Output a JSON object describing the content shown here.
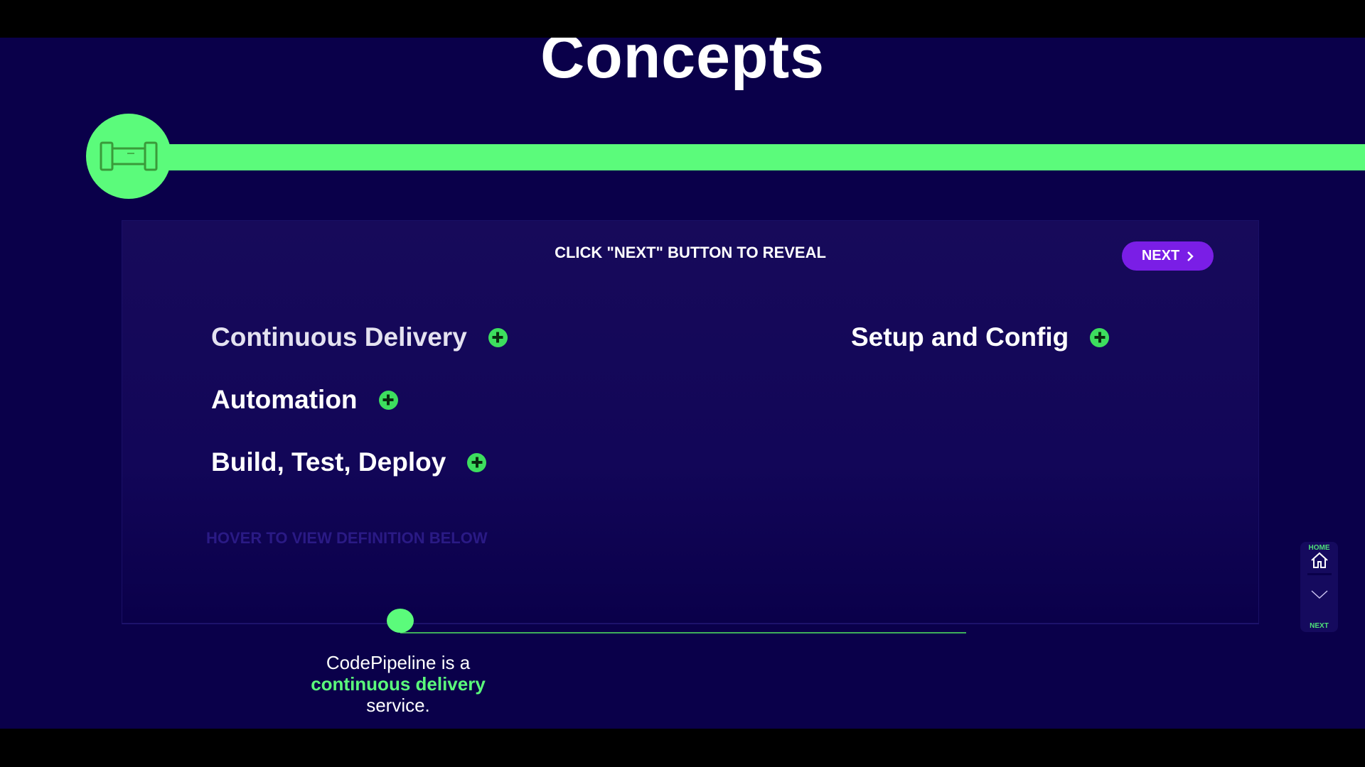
{
  "title": "Concepts",
  "header_icon": "pipeline-icon",
  "panel": {
    "hint": "CLICK \"NEXT\" BUTTON TO REVEAL",
    "next_label": "NEXT",
    "items": [
      {
        "label": "Continuous Delivery"
      },
      {
        "label": "Automation"
      },
      {
        "label": "Build, Test, Deploy"
      },
      {
        "label": "Setup and Config"
      }
    ],
    "hover_hint": "HOVER TO VIEW DEFINITION BELOW"
  },
  "caption": {
    "pre": "CodePipeline is a",
    "highlight": "continuous delivery",
    "post": "service."
  },
  "side_nav": {
    "home": "HOME",
    "next": "NEXT"
  },
  "colors": {
    "background": "#0a004a",
    "accent": "#5bfb7b",
    "button": "#7a1ee6"
  }
}
